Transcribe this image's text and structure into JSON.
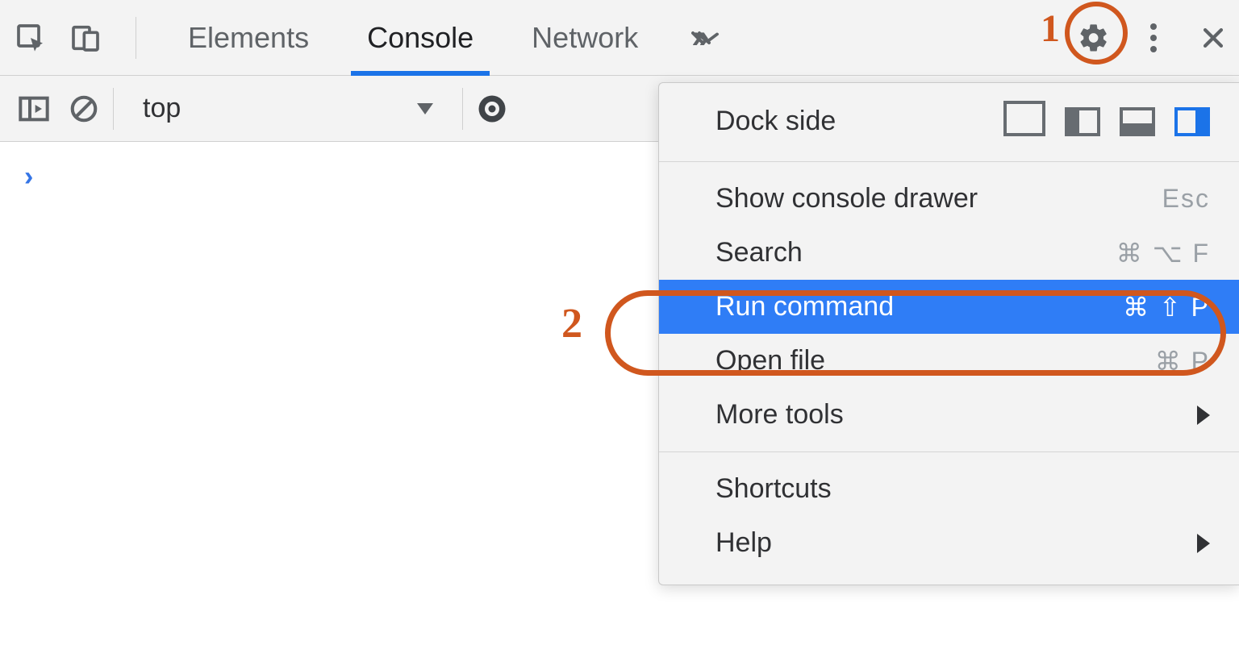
{
  "toolbar": {
    "tabs": [
      "Elements",
      "Console",
      "Network"
    ],
    "active_tab": "Console"
  },
  "subbar": {
    "context": "top"
  },
  "console": {
    "prompt": "›"
  },
  "menu": {
    "dock_label": "Dock side",
    "items": [
      {
        "label": "Show console drawer",
        "shortcut": "Esc"
      },
      {
        "label": "Search",
        "shortcut": "⌘ ⌥ F"
      },
      {
        "label": "Run command",
        "shortcut": "⌘ ⇧ P",
        "selected": true
      },
      {
        "label": "Open file",
        "shortcut": "⌘ P"
      },
      {
        "label": "More tools",
        "submenu": true
      }
    ],
    "footer": [
      {
        "label": "Shortcuts"
      },
      {
        "label": "Help",
        "submenu": true
      }
    ]
  },
  "annotations": {
    "n1": "1",
    "n2": "2"
  }
}
